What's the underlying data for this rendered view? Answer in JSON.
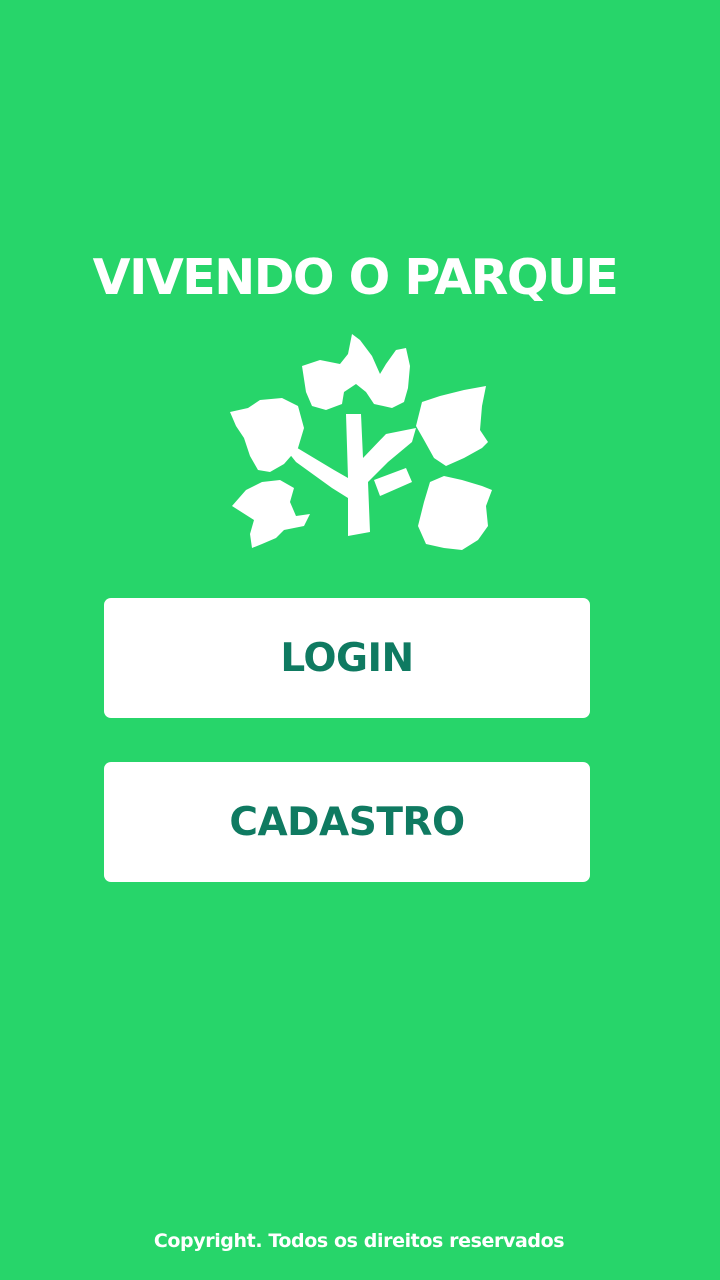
{
  "app": {
    "title": "VIVENDO O PARQUE",
    "logo_icon": "tree-leaves-icon"
  },
  "actions": {
    "login_label": "LOGIN",
    "register_label": "CADASTRO"
  },
  "footer": {
    "copyright": "Copyright. Todos os direitos reservados"
  },
  "colors": {
    "background": "#27D56A",
    "button_background": "#FFFFFF",
    "button_text": "#0F7A61",
    "title_text": "#FFFFFF",
    "logo": "#FFFFFF"
  }
}
